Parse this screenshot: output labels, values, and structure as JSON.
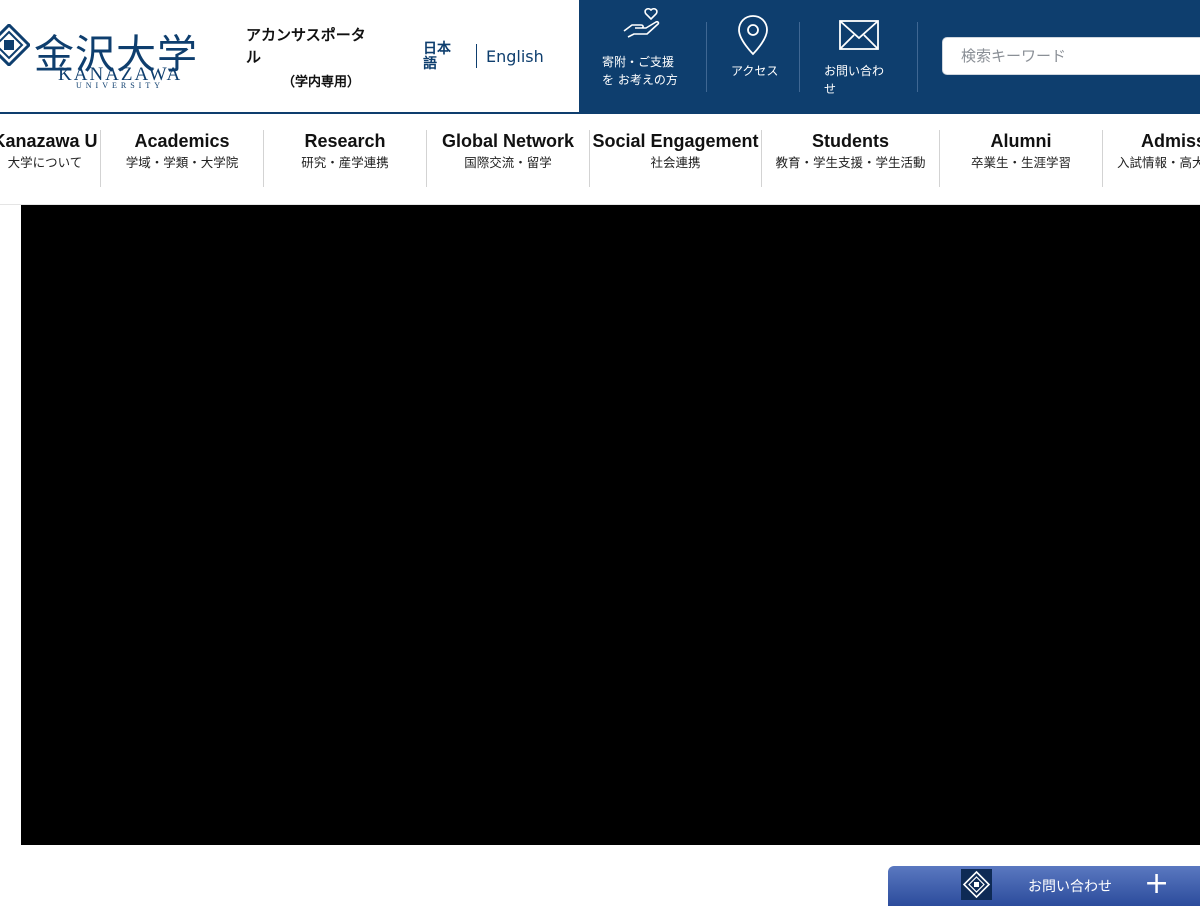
{
  "header": {
    "logo": {
      "kanji": "金沢大学",
      "roman": "KANAZAWA",
      "sub": "UNIVERSITY"
    },
    "portal": {
      "label": "アカンサスポータル",
      "sub": "（学内専用）"
    },
    "languages": {
      "japanese": "日本語",
      "english": "English"
    },
    "links": [
      {
        "label": "寄附・ご支援を お考えの方",
        "icon": "heart-hand-icon"
      },
      {
        "label": "アクセス",
        "icon": "map-pin-icon"
      },
      {
        "label": "お問い合わせ",
        "icon": "mail-icon"
      }
    ],
    "search": {
      "placeholder": "検索キーワード",
      "value": ""
    }
  },
  "nav": {
    "items": [
      {
        "en": "Kanazawa U",
        "ja": "大学について"
      },
      {
        "en": "Academics",
        "ja": "学域・学類・大学院"
      },
      {
        "en": "Research",
        "ja": "研究・産学連携"
      },
      {
        "en": "Global Network",
        "ja": "国際交流・留学"
      },
      {
        "en": "Social Engagement",
        "ja": "社会連携"
      },
      {
        "en": "Students",
        "ja": "教育・学生支援・学生活動"
      },
      {
        "en": "Alumni",
        "ja": "卒業生・生涯学習"
      },
      {
        "en": "Admissions",
        "ja": "入試情報・高大接続"
      }
    ]
  },
  "float_contact": {
    "label": "お問い合わせ",
    "icon": "plus-icon"
  },
  "colors": {
    "brand": "#0e3e6e",
    "float_bar": "#3d5cad"
  }
}
